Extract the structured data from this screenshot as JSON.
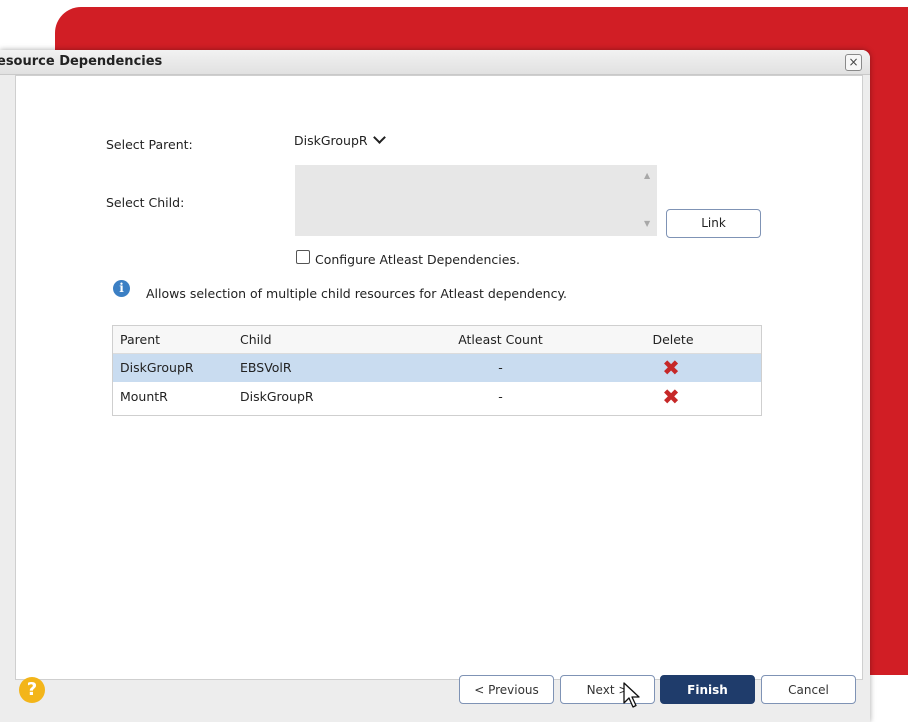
{
  "dialog": {
    "title": "esource Dependencies",
    "close_glyph": "×"
  },
  "form": {
    "parent_label": "Select Parent:",
    "parent_value": "DiskGroupR",
    "child_label": "Select Child:",
    "link_label": "Link",
    "atleast_label": "Configure Atleast Dependencies.",
    "atleast_checked": false,
    "info_glyph": "i",
    "info_text": "Allows selection of multiple child resources for Atleast dependency."
  },
  "table": {
    "headers": [
      "Parent",
      "Child",
      "Atleast Count",
      "Delete"
    ],
    "rows": [
      {
        "parent": "DiskGroupR",
        "child": "EBSVolR",
        "count": "-"
      },
      {
        "parent": "MountR",
        "child": "DiskGroupR",
        "count": "-"
      }
    ]
  },
  "footer": {
    "help_glyph": "?",
    "previous_label": "< Previous",
    "next_label": "Next >",
    "finish_label": "Finish",
    "cancel_label": "Cancel"
  },
  "colors": {
    "accent_red": "#d11e25",
    "finish_button": "#1f3c6b",
    "selected_row": "#c9dcf0",
    "delete_icon": "#c62828",
    "help_icon": "#f3b51a",
    "info_icon": "#3b7fc4"
  }
}
